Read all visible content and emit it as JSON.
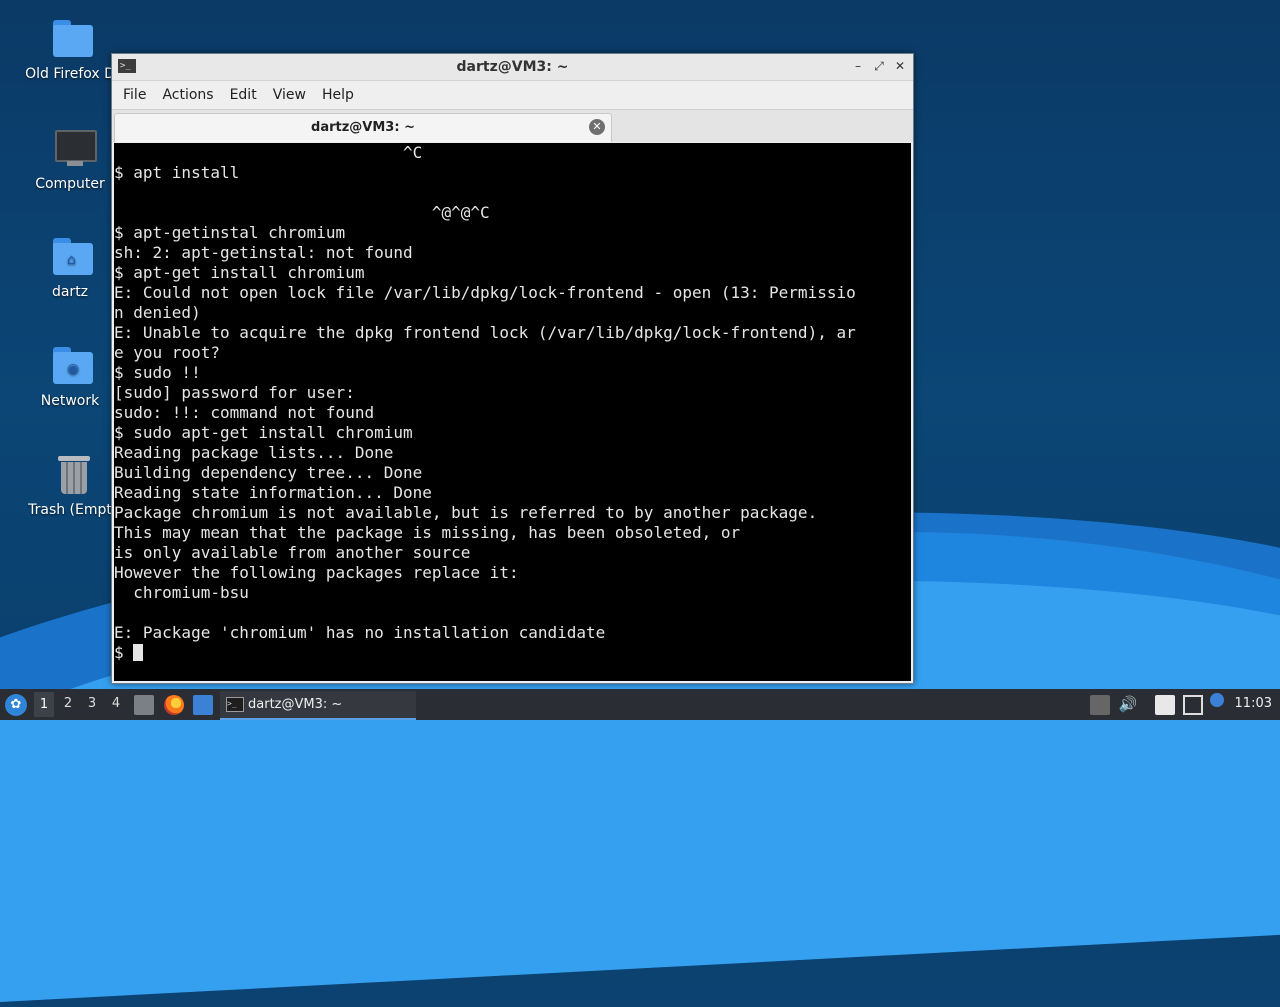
{
  "desktop": {
    "icons": [
      {
        "label": "Old Firefox D",
        "icon": "folder-icon"
      },
      {
        "label": "Computer",
        "icon": "computer-icon"
      },
      {
        "label": "dartz",
        "icon": "home-folder-icon"
      },
      {
        "label": "Network",
        "icon": "network-folder-icon"
      },
      {
        "label": "Trash (Empt",
        "icon": "trash-icon"
      }
    ]
  },
  "window": {
    "title": "dartz@VM3: ~",
    "menu": [
      "File",
      "Actions",
      "Edit",
      "View",
      "Help"
    ],
    "tab_title": "dartz@VM3: ~",
    "terminal_lines": [
      "                              ^C",
      "$ apt install",
      "",
      "                                 ^@^@^C",
      "$ apt-getinstal chromium",
      "sh: 2: apt-getinstal: not found",
      "$ apt-get install chromium",
      "E: Could not open lock file /var/lib/dpkg/lock-frontend - open (13: Permissio",
      "n denied)",
      "E: Unable to acquire the dpkg frontend lock (/var/lib/dpkg/lock-frontend), ar",
      "e you root?",
      "$ sudo !!",
      "[sudo] password for user:",
      "sudo: !!: command not found",
      "$ sudo apt-get install chromium",
      "Reading package lists... Done",
      "Building dependency tree... Done",
      "Reading state information... Done",
      "Package chromium is not available, but is referred to by another package.",
      "This may mean that the package is missing, has been obsoleted, or",
      "is only available from another source",
      "However the following packages replace it:",
      "  chromium-bsu",
      "",
      "E: Package 'chromium' has no installation candidate"
    ],
    "prompt": "$ "
  },
  "taskbar": {
    "workspaces": [
      "1",
      "2",
      "3",
      "4"
    ],
    "active_task": "dartz@VM3: ~",
    "clock": "11:03"
  }
}
